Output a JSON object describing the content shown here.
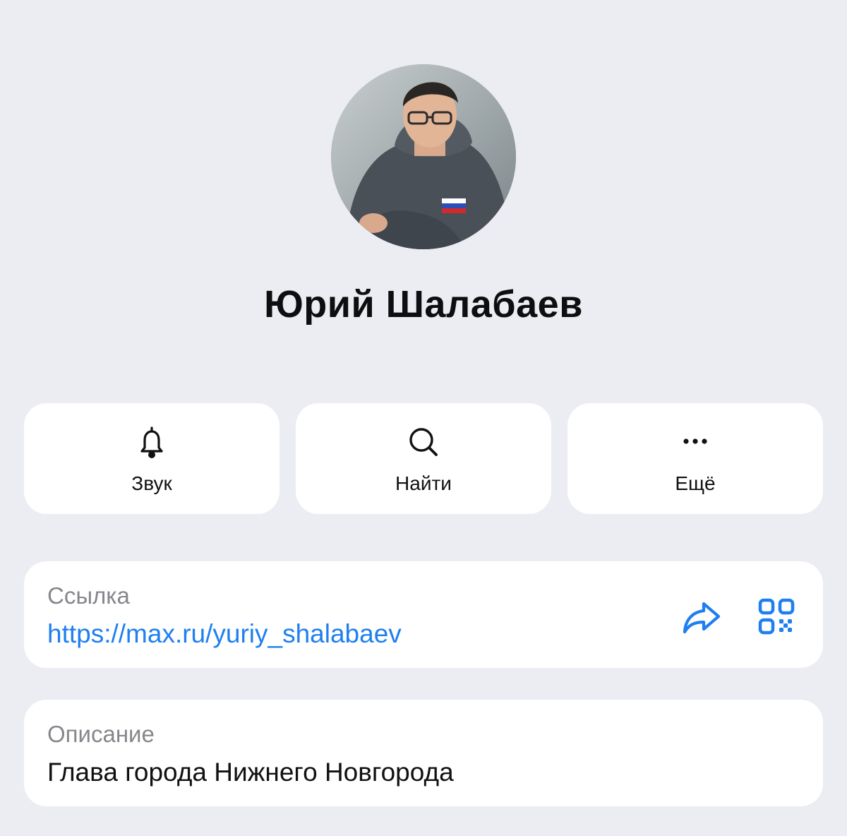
{
  "profile": {
    "name": "Юрий Шалабаев"
  },
  "actions": [
    {
      "label": "Звук",
      "icon": "bell-icon"
    },
    {
      "label": "Найти",
      "icon": "search-icon"
    },
    {
      "label": "Ещё",
      "icon": "more-dots-icon"
    }
  ],
  "link_card": {
    "label": "Ссылка",
    "value": "https://max.ru/yuriy_shalabaev",
    "share_icon": "share-arrow-icon",
    "qr_icon": "qr-code-icon"
  },
  "description_card": {
    "label": "Описание",
    "value": "Глава города Нижнего Новгорода"
  },
  "colors": {
    "background": "#ecedf2",
    "card": "#ffffff",
    "accent": "#1e7ff0",
    "secondary_text": "#86878c",
    "primary_text": "#111114"
  }
}
